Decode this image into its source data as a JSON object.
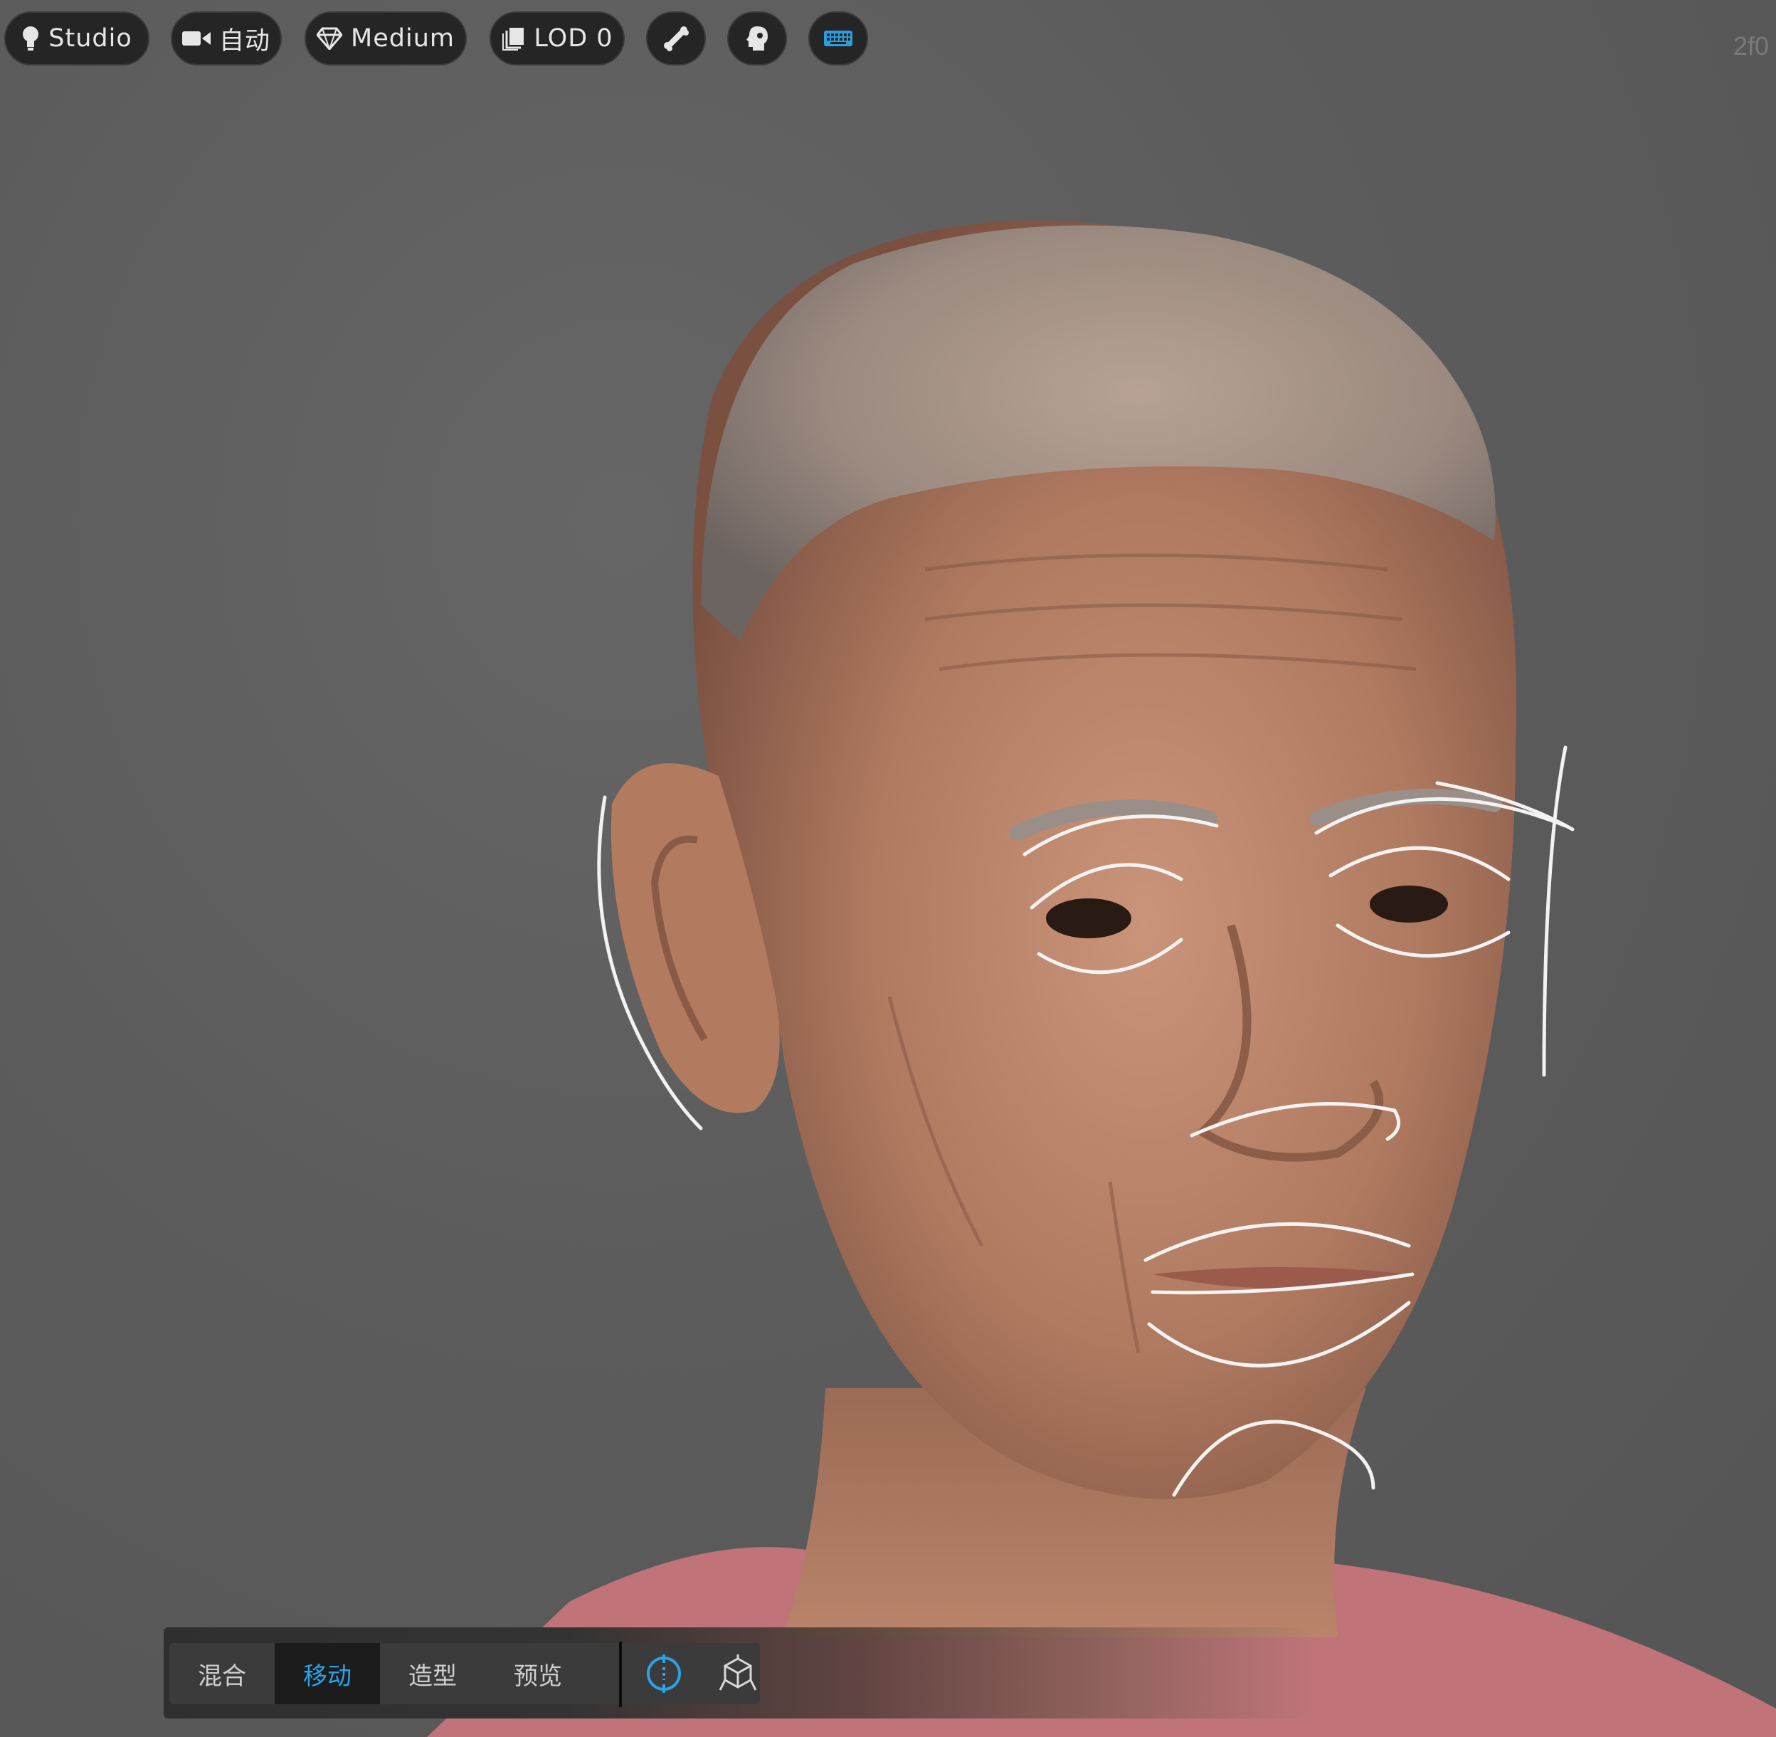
{
  "toolbar": {
    "lighting_label": "Studio",
    "camera_label": "自动",
    "quality_label": "Medium",
    "lod_label": "LOD 0",
    "icons": [
      "lightbulb-icon",
      "video-camera-icon",
      "diamond-icon",
      "layers-icon",
      "bone-icon",
      "head-icon",
      "keyboard-icon"
    ],
    "keyboard_accent": "#2a9fe0"
  },
  "watermark": "2f0",
  "mode_bar": {
    "tabs": [
      "混合",
      "移动",
      "造型",
      "预览"
    ],
    "active_tab": "移动",
    "tool_icons": [
      "gizmo-circle-icon",
      "cube-transform-icon"
    ],
    "accent": "#2aa2e6"
  }
}
